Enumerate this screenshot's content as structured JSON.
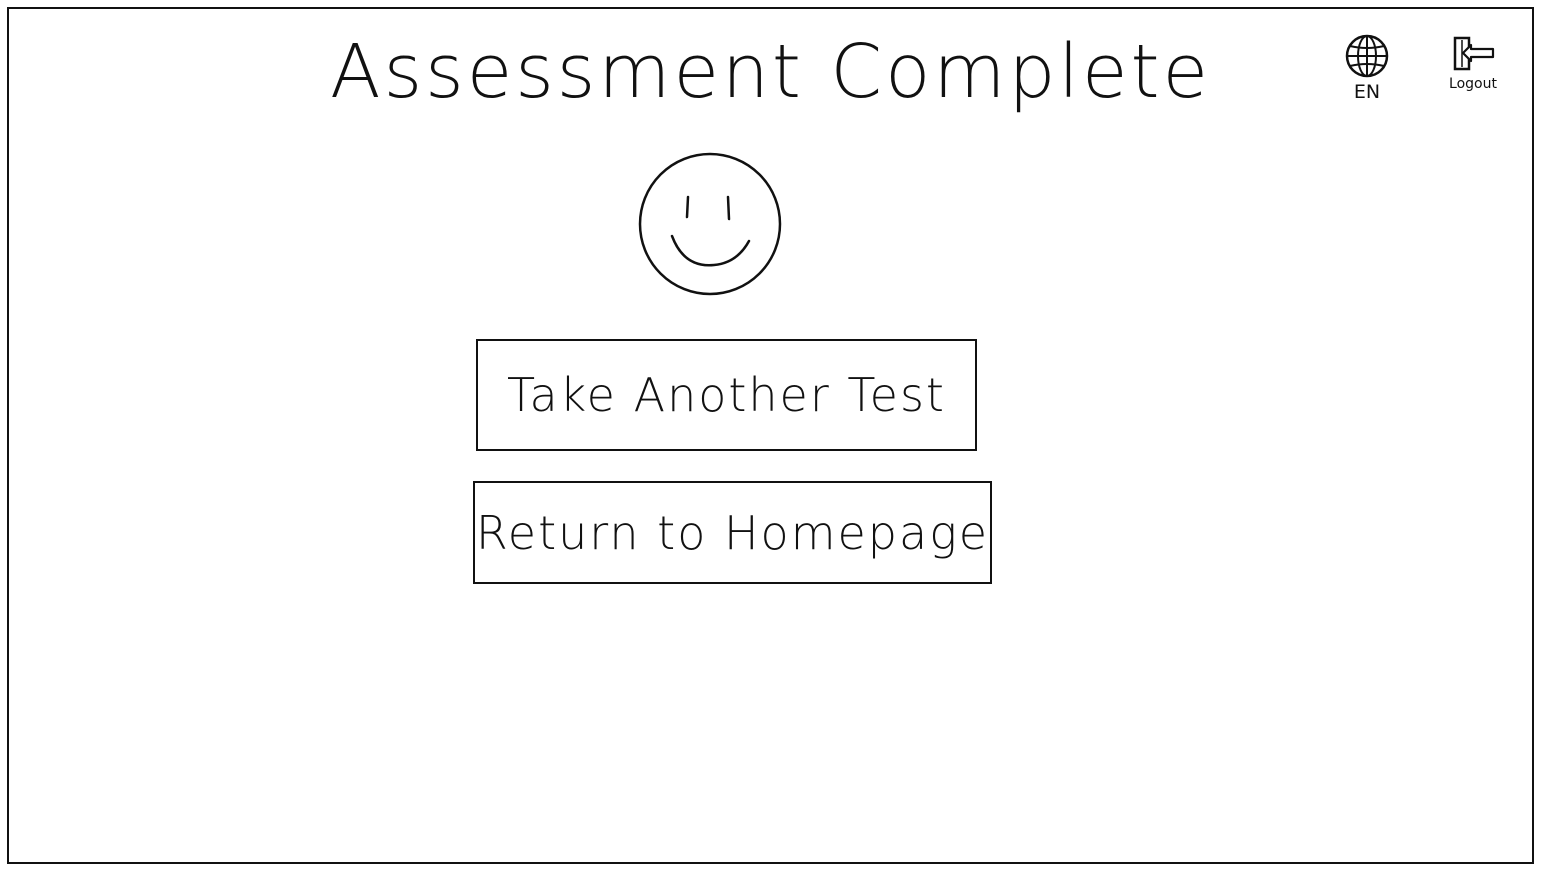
{
  "page": {
    "title": "Assessment Complete"
  },
  "header": {
    "language": {
      "icon": "globe-icon",
      "label": "EN"
    },
    "logout": {
      "icon": "logout-door-icon",
      "label": "Logout"
    }
  },
  "result": {
    "icon": "smiley-face-icon"
  },
  "actions": {
    "take_another_test_label": "Take Another Test",
    "return_home_label": "Return to Homepage"
  },
  "colors": {
    "ink": "#111111",
    "background": "#ffffff"
  }
}
